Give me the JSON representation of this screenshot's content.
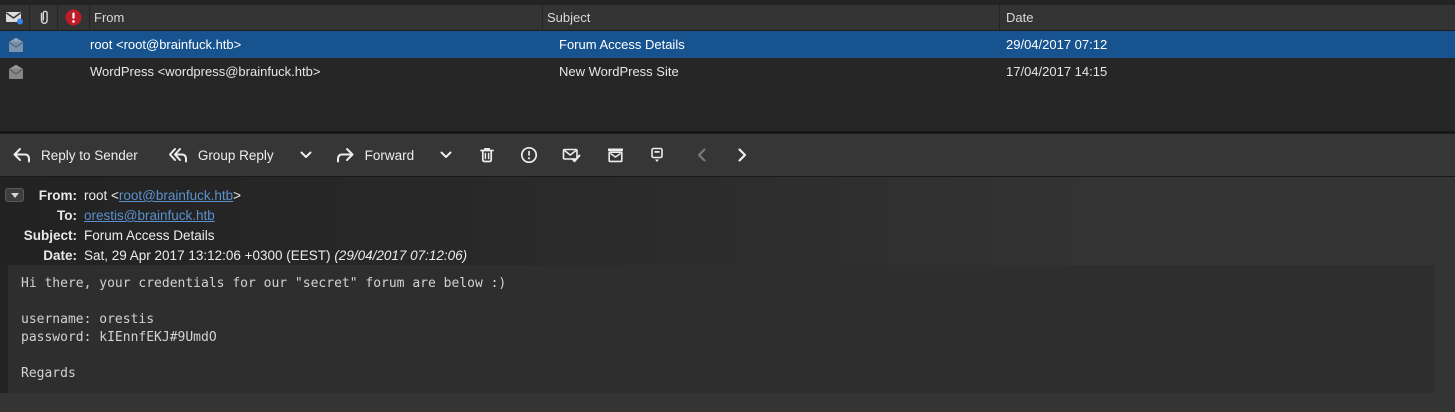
{
  "colors": {
    "selection_blue": "#17538f",
    "link_blue": "#5a91ce",
    "junk_red": "#c01c28",
    "unread_dot_blue": "#3584e4",
    "toolbar_bg": "#363636",
    "list_bg": "#262626",
    "body_bg": "#2e2e2e"
  },
  "thread_pane": {
    "column_icons": [
      "read-status-envelope-icon",
      "attachment-paperclip-icon",
      "junk-priority-icon"
    ],
    "columns": {
      "from": "From",
      "subject": "Subject",
      "date": "Date"
    },
    "messages": [
      {
        "from": "root <root@brainfuck.htb>",
        "subject": "Forum Access Details",
        "date": "29/04/2017 07:12",
        "selected": true
      },
      {
        "from": "WordPress <wordpress@brainfuck.htb>",
        "subject": "New WordPress Site",
        "date": "17/04/2017 14:15",
        "selected": false
      }
    ]
  },
  "toolbar": {
    "reply_label": "Reply to Sender",
    "group_reply_label": "Group Reply",
    "forward_label": "Forward",
    "icon_buttons": [
      "delete-trash-icon",
      "junk-icon",
      "mark-read-icon",
      "archive-icon",
      "tag-icon"
    ],
    "nav": [
      "previous-message-icon",
      "next-message-icon"
    ]
  },
  "message_header": {
    "from_label": "From:",
    "from_prefix": "root <",
    "from_link": "root@brainfuck.htb",
    "from_suffix": ">",
    "to_label": "To:",
    "to_link": "orestis@brainfuck.htb",
    "subject_label": "Subject:",
    "subject_value": "Forum Access Details",
    "date_label": "Date:",
    "date_value": "Sat, 29 Apr 2017 13:12:06 +0300 (EEST) ",
    "date_alt": "(29/04/2017 07:12:06)"
  },
  "message_body": {
    "text": "Hi there, your credentials for our \"secret\" forum are below :)\n\nusername: orestis\npassword: kIEnnfEKJ#9UmdO\n\nRegards"
  }
}
